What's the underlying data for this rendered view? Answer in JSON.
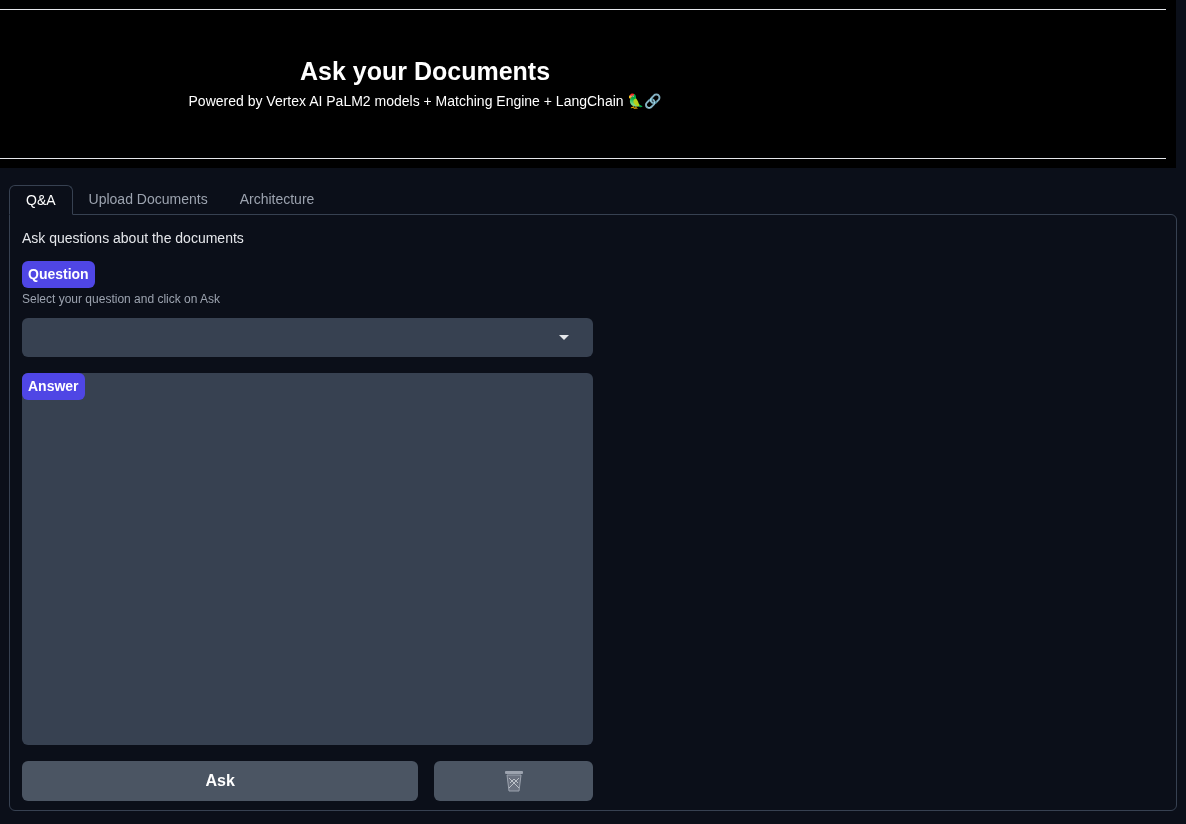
{
  "header": {
    "title": "Ask your Documents",
    "subtitle": "Powered by Vertex AI PaLM2 models + Matching Engine + LangChain 🦜🔗"
  },
  "tabs": [
    {
      "label": "Q&A",
      "selected": true
    },
    {
      "label": "Upload Documents",
      "selected": false
    },
    {
      "label": "Architecture",
      "selected": false
    }
  ],
  "panel": {
    "intro": "Ask questions about the documents",
    "question": {
      "label": "Question",
      "info": "Select your question and click on Ask"
    },
    "answer": {
      "label": "Answer"
    },
    "buttons": [
      {
        "kind": "text",
        "label": "Ask"
      },
      {
        "kind": "trash"
      }
    ]
  }
}
